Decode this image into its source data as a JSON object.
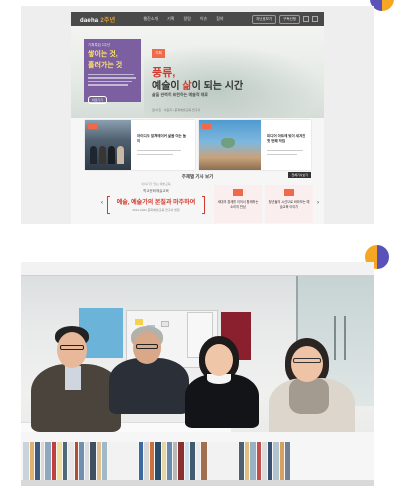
{
  "colors": {
    "accent_red": "#d23c2f",
    "badge_orange": "#f06a4a",
    "purple_panel": "#7b5fa0",
    "deco_circle_blue": "#5a52b8",
    "deco_circle_orange": "#f5a623"
  },
  "website": {
    "logo": "daeha",
    "logo_mark": "2주년",
    "nav_menu": [
      "웹진소개",
      "기획",
      "칼럼",
      "이슈",
      "참여"
    ],
    "nav_tools": [
      "지난호보기",
      "구독신청"
    ],
    "hero": {
      "purple_small": "기획특집 2주년",
      "purple_big_1": "쌓이는 것,",
      "purple_big_2": "흘러가는 것",
      "purple_button": "바로가기",
      "badge": "기획",
      "title_1": "풍류,",
      "title_2_a": "예술이 ",
      "title_2_b": "삶",
      "title_2_c": "이 되는 시간",
      "subtitle": "삶을 완벽히 표현하는 예술적 재료",
      "caption": "글/사진 · 이윤지 / 문화예술교육 연구자"
    },
    "cards": [
      {
        "badge": "인터뷰",
        "title": "아이디오 컬쳐메이커 삶을 여는 놀이"
      },
      {
        "badge": "칼럼",
        "title": "미디어 아트에 빛이 새겨진 첫 번째 작업"
      }
    ],
    "topic_heading": "주제별 기사 보기",
    "topic_button": "전체기사보기",
    "promo": {
      "line1": "이야기가 있는 예술교육",
      "line2": "학교문화예술교육",
      "headline": "예술, 예술가의 본질과 마주하여",
      "line4": "2021-2022 문화예술교육 연구의 방향"
    },
    "mini_cards": [
      {
        "title": "세대의 경계를 이어서 함께하는 소리의 만남"
      },
      {
        "title": "청년들의 시선으로 바라보는 예술교육 이야기"
      }
    ]
  },
  "photo": {
    "subject": "four people seated at library bookshelves"
  }
}
